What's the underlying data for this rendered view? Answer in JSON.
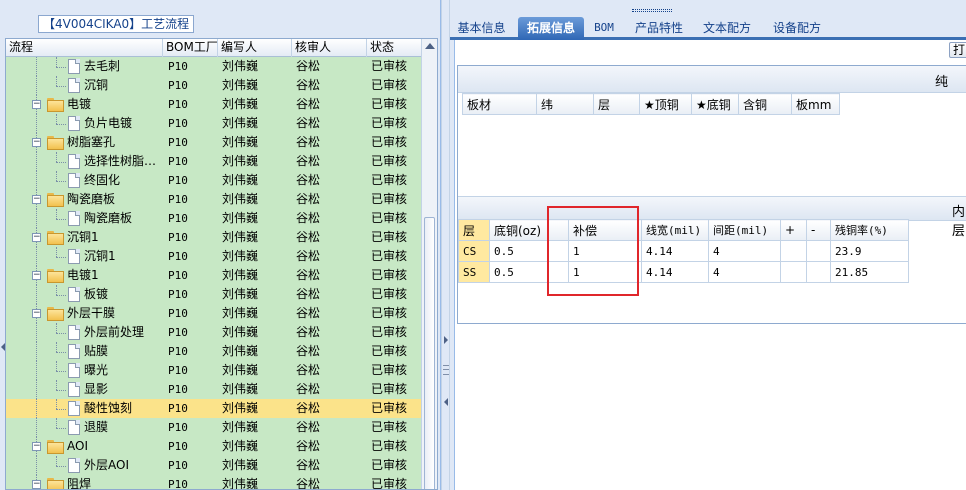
{
  "left_panel": {
    "group_title": "【4V004CIKA0】工艺流程",
    "columns": [
      "流程",
      "BOM工厂",
      "编写人",
      "核审人",
      "状态"
    ],
    "rows": [
      {
        "level": 2,
        "type": "file",
        "name": "去毛刺",
        "bom": "P10",
        "writer": "刘伟巍",
        "checker": "谷松",
        "status": "已审核"
      },
      {
        "level": 2,
        "type": "file",
        "name": "沉铜",
        "bom": "P10",
        "writer": "刘伟巍",
        "checker": "谷松",
        "status": "已审核"
      },
      {
        "level": 1,
        "type": "folder",
        "name": "电镀",
        "bom": "P10",
        "writer": "刘伟巍",
        "checker": "谷松",
        "status": "已审核"
      },
      {
        "level": 2,
        "type": "file",
        "name": "负片电镀",
        "bom": "P10",
        "writer": "刘伟巍",
        "checker": "谷松",
        "status": "已审核"
      },
      {
        "level": 1,
        "type": "folder",
        "name": "树脂塞孔",
        "bom": "P10",
        "writer": "刘伟巍",
        "checker": "谷松",
        "status": "已审核"
      },
      {
        "level": 2,
        "type": "file",
        "name": "选择性树脂…",
        "bom": "P10",
        "writer": "刘伟巍",
        "checker": "谷松",
        "status": "已审核"
      },
      {
        "level": 2,
        "type": "file",
        "name": "终固化",
        "bom": "P10",
        "writer": "刘伟巍",
        "checker": "谷松",
        "status": "已审核"
      },
      {
        "level": 1,
        "type": "folder",
        "name": "陶瓷磨板",
        "bom": "P10",
        "writer": "刘伟巍",
        "checker": "谷松",
        "status": "已审核"
      },
      {
        "level": 2,
        "type": "file",
        "name": "陶瓷磨板",
        "bom": "P10",
        "writer": "刘伟巍",
        "checker": "谷松",
        "status": "已审核"
      },
      {
        "level": 1,
        "type": "folder",
        "name": "沉铜1",
        "bom": "P10",
        "writer": "刘伟巍",
        "checker": "谷松",
        "status": "已审核"
      },
      {
        "level": 2,
        "type": "file",
        "name": "沉铜1",
        "bom": "P10",
        "writer": "刘伟巍",
        "checker": "谷松",
        "status": "已审核"
      },
      {
        "level": 1,
        "type": "folder",
        "name": "电镀1",
        "bom": "P10",
        "writer": "刘伟巍",
        "checker": "谷松",
        "status": "已审核"
      },
      {
        "level": 2,
        "type": "file",
        "name": "板镀",
        "bom": "P10",
        "writer": "刘伟巍",
        "checker": "谷松",
        "status": "已审核"
      },
      {
        "level": 1,
        "type": "folder",
        "name": "外层干膜",
        "bom": "P10",
        "writer": "刘伟巍",
        "checker": "谷松",
        "status": "已审核"
      },
      {
        "level": 2,
        "type": "file",
        "name": "外层前处理",
        "bom": "P10",
        "writer": "刘伟巍",
        "checker": "谷松",
        "status": "已审核"
      },
      {
        "level": 2,
        "type": "file",
        "name": "贴膜",
        "bom": "P10",
        "writer": "刘伟巍",
        "checker": "谷松",
        "status": "已审核"
      },
      {
        "level": 2,
        "type": "file",
        "name": "曝光",
        "bom": "P10",
        "writer": "刘伟巍",
        "checker": "谷松",
        "status": "已审核"
      },
      {
        "level": 2,
        "type": "file",
        "name": "显影",
        "bom": "P10",
        "writer": "刘伟巍",
        "checker": "谷松",
        "status": "已审核"
      },
      {
        "level": 2,
        "type": "file",
        "name": "酸性蚀刻",
        "bom": "P10",
        "writer": "刘伟巍",
        "checker": "谷松",
        "status": "已审核",
        "selected": true
      },
      {
        "level": 2,
        "type": "file",
        "name": "退膜",
        "bom": "P10",
        "writer": "刘伟巍",
        "checker": "谷松",
        "status": "已审核"
      },
      {
        "level": 1,
        "type": "folder",
        "name": "AOI",
        "bom": "P10",
        "writer": "刘伟巍",
        "checker": "谷松",
        "status": "已审核"
      },
      {
        "level": 2,
        "type": "file",
        "name": "外层AOI",
        "bom": "P10",
        "writer": "刘伟巍",
        "checker": "谷松",
        "status": "已审核"
      },
      {
        "level": 1,
        "type": "folder",
        "name": "阻焊",
        "bom": "P10",
        "writer": "刘伟巍",
        "checker": "谷松",
        "status": "已审核"
      }
    ],
    "folder_icon": "folder-icon",
    "file_icon": "document-icon"
  },
  "right_panel": {
    "tabs": [
      {
        "id": "basic",
        "label": "基本信息",
        "active": false
      },
      {
        "id": "ext",
        "label": "拓展信息",
        "active": true
      },
      {
        "id": "bom",
        "label": "BOM",
        "active": false
      },
      {
        "id": "features",
        "label": "产品特性",
        "active": false
      },
      {
        "id": "text",
        "label": "文本配方",
        "active": false
      },
      {
        "id": "device",
        "label": "设备配方",
        "active": false
      }
    ],
    "toolbar_button": "打",
    "section1_title": "纯",
    "table1_headers": [
      "板材",
      "纬",
      "层",
      "★顶铜",
      "★底铜",
      "含铜",
      "板mm"
    ],
    "section2_title": "内层",
    "table2_headers": [
      "层",
      "底铜(oz)",
      "补偿",
      "线宽(mil)",
      "间距(mil)",
      "+",
      "-",
      "残铜率(%)"
    ],
    "table2_rows": [
      [
        "CS",
        "0.5",
        "1",
        "4.14",
        "4",
        "",
        "",
        "23.9"
      ],
      [
        "SS",
        "0.5",
        "1",
        "4.14",
        "4",
        "",
        "",
        "21.85"
      ]
    ],
    "highlight_color": "#e0262b"
  }
}
